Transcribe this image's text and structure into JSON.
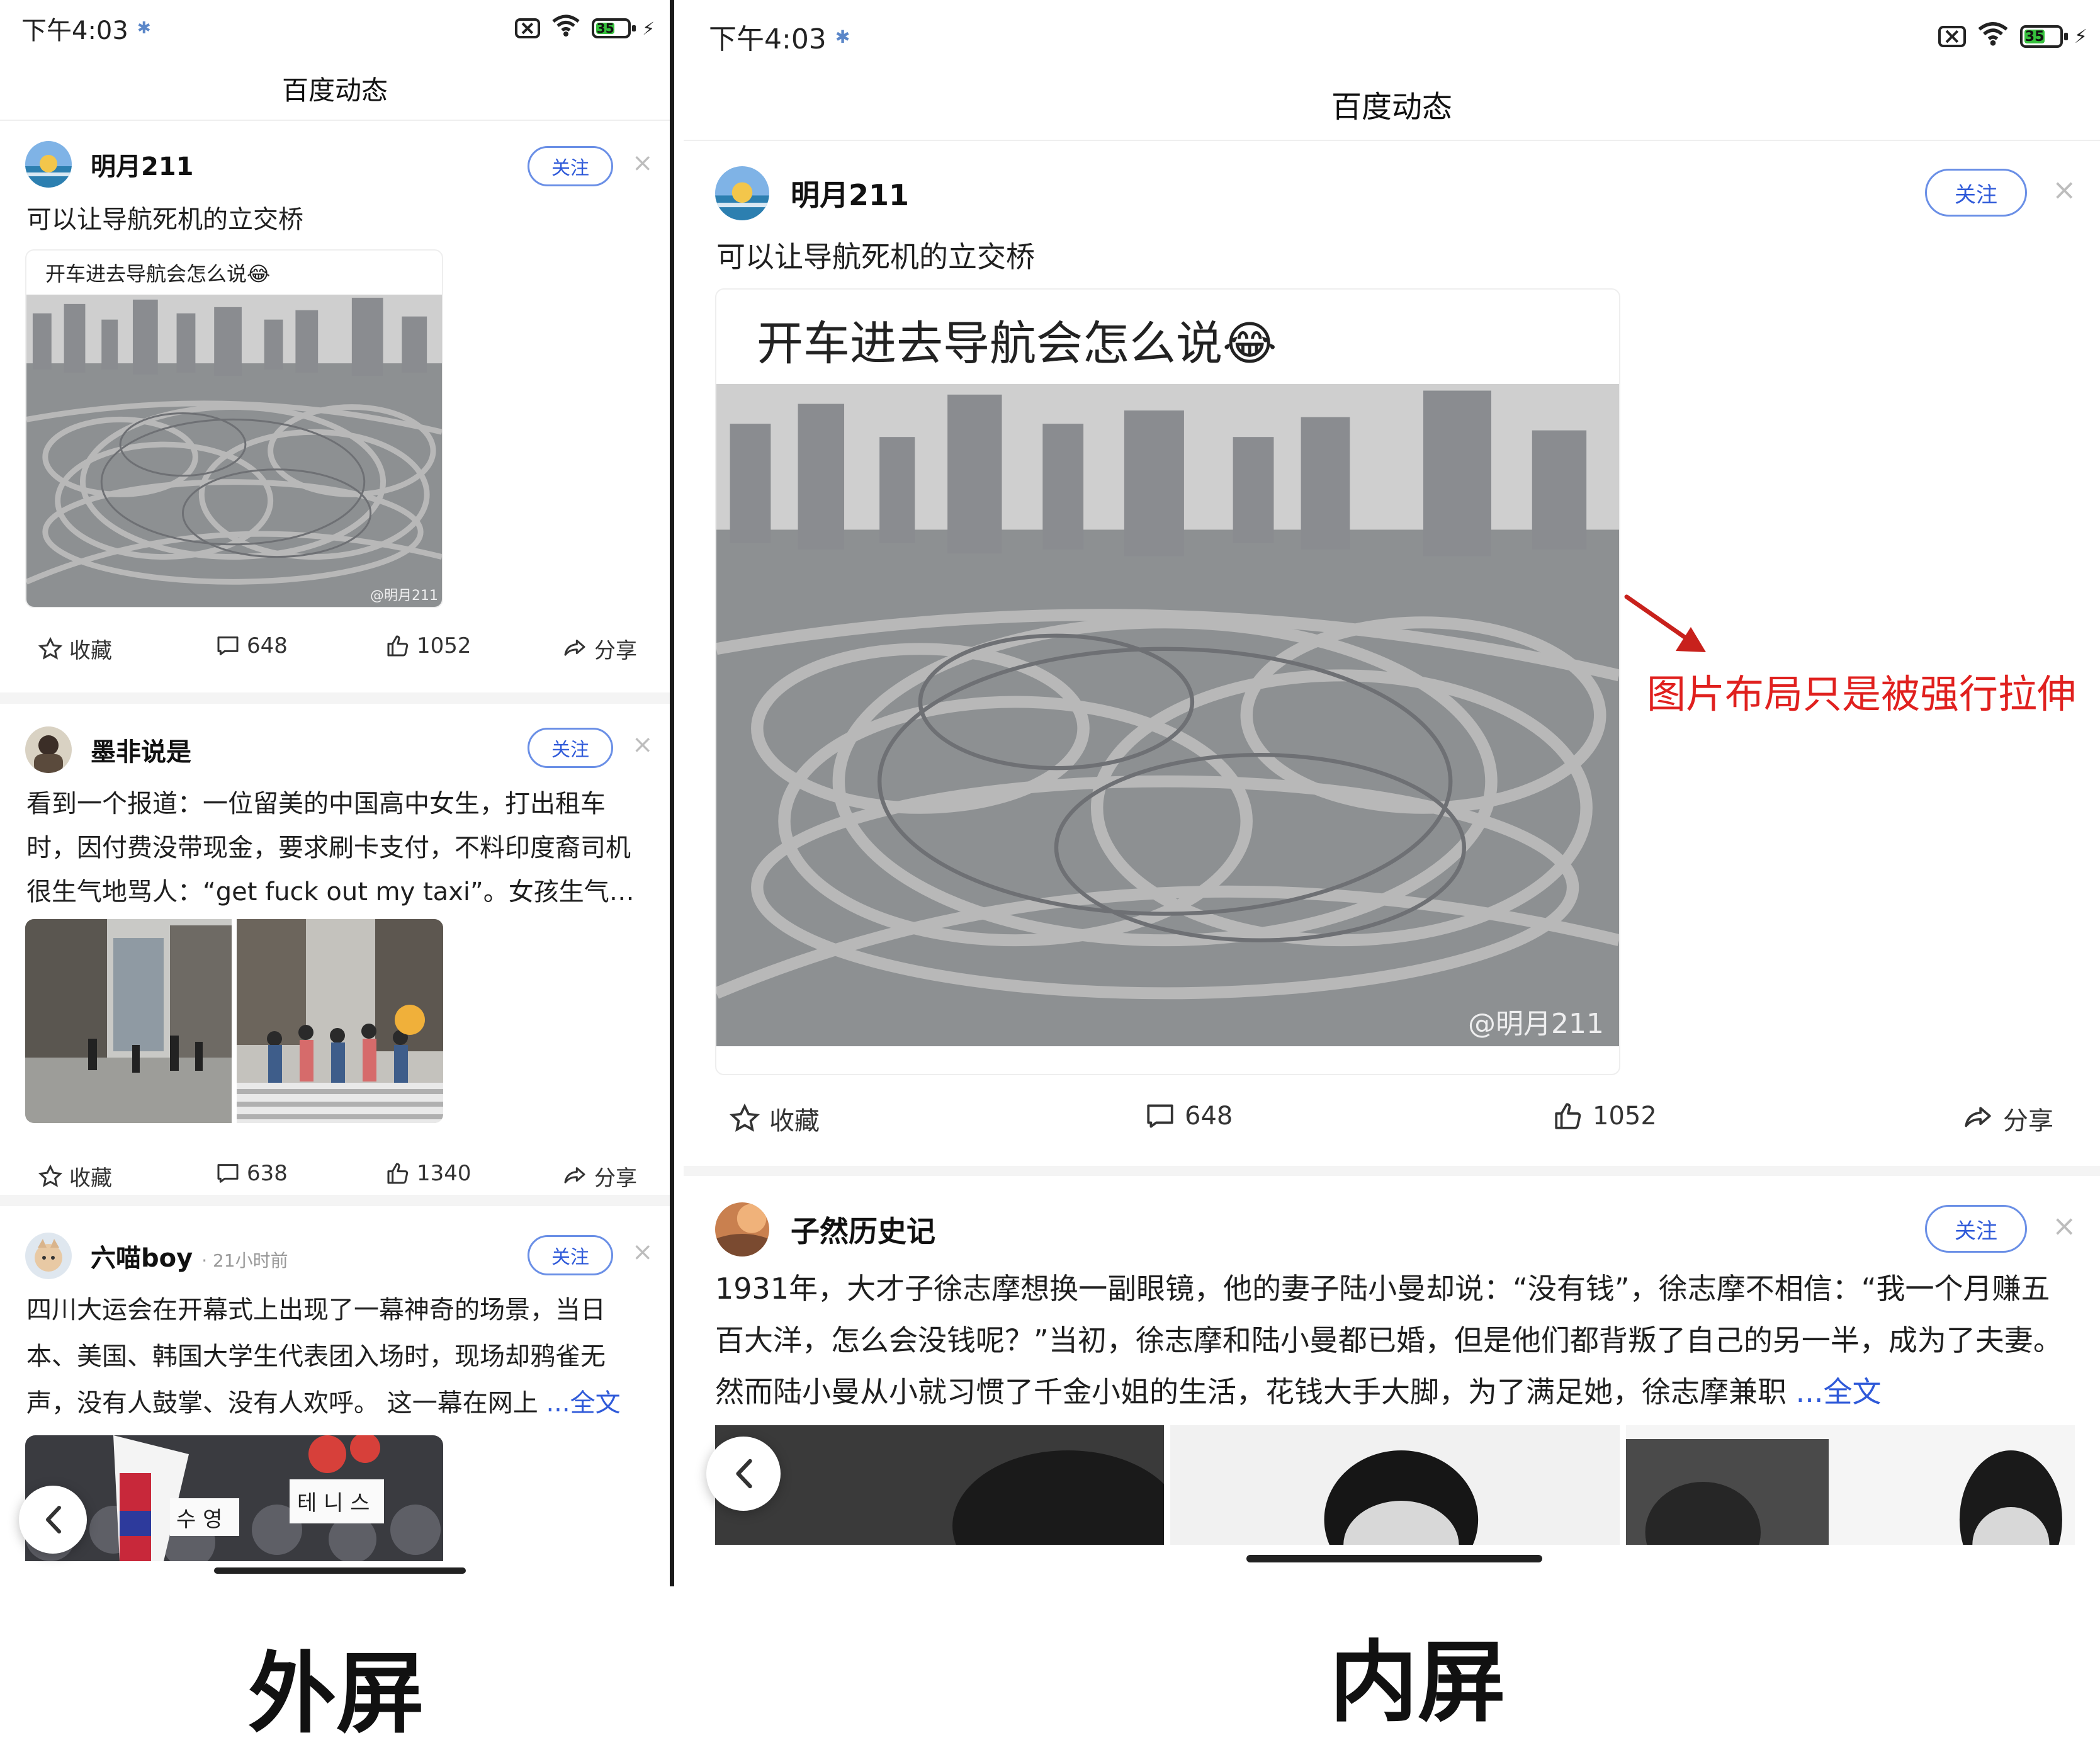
{
  "status": {
    "time": "下午4:03",
    "battery": "35"
  },
  "nav": {
    "title": "百度动态"
  },
  "post1": {
    "author": "明月211",
    "follow": "关注",
    "close": "×",
    "text": "可以让导航死机的立交桥",
    "card_caption": "开车进去导航会怎么说😂",
    "watermark": "@明月211",
    "actions": {
      "fav": "收藏",
      "comments": "648",
      "likes": "1052",
      "share": "分享"
    }
  },
  "post2": {
    "author": "墨非说是",
    "follow": "关注",
    "close": "×",
    "text": "看到一个报道：一位留美的中国高中女生，打出租车时，因付费没带现金，要求刷卡支付，不料印度裔司机很生气地骂人：“get fuck out my taxi”。女孩生气…",
    "actions": {
      "fav": "收藏",
      "comments": "638",
      "likes": "1340",
      "share": "分享"
    }
  },
  "post3": {
    "author": "六喵boy",
    "time": "· 21小时前",
    "follow": "关注",
    "close": "×",
    "text": "四川大运会在开幕式上出现了一幕神奇的场景，当日本、美国、韩国大学生代表团入场时，现场却鸦雀无声，没有人鼓掌、没有人欢呼。 这一幕在网上 ",
    "more": "...全文",
    "sign1": "수 영",
    "sign2": "테 니 스"
  },
  "post_inner2": {
    "author": "子然历史记",
    "follow": "关注",
    "close": "×",
    "text": "1931年，大才子徐志摩想换一副眼镜，他的妻子陆小曼却说：“没有钱”，徐志摩不相信：“我一个月赚五百大洋，怎么会没钱呢？”当初，徐志摩和陆小曼都已婚，但是他们都背叛了自己的另一半，成为了夫妻。 然而陆小曼从小就习惯了千金小姐的生活，花钱大手大脚，为了满足她，徐志摩兼职 ",
    "more": "...全文"
  },
  "labels": {
    "outer": "外屏",
    "inner": "内屏"
  },
  "annotation": "图片布局只是被强行拉伸",
  "colors": {
    "accent": "#2f5ad9",
    "annotation": "#e0201e",
    "battery": "#35c03c"
  },
  "icons": [
    "star-icon",
    "comment-icon",
    "thumbs-up-icon",
    "share-icon",
    "close-icon",
    "chevron-left-icon",
    "wifi-icon",
    "battery-icon",
    "sim-off-icon"
  ]
}
